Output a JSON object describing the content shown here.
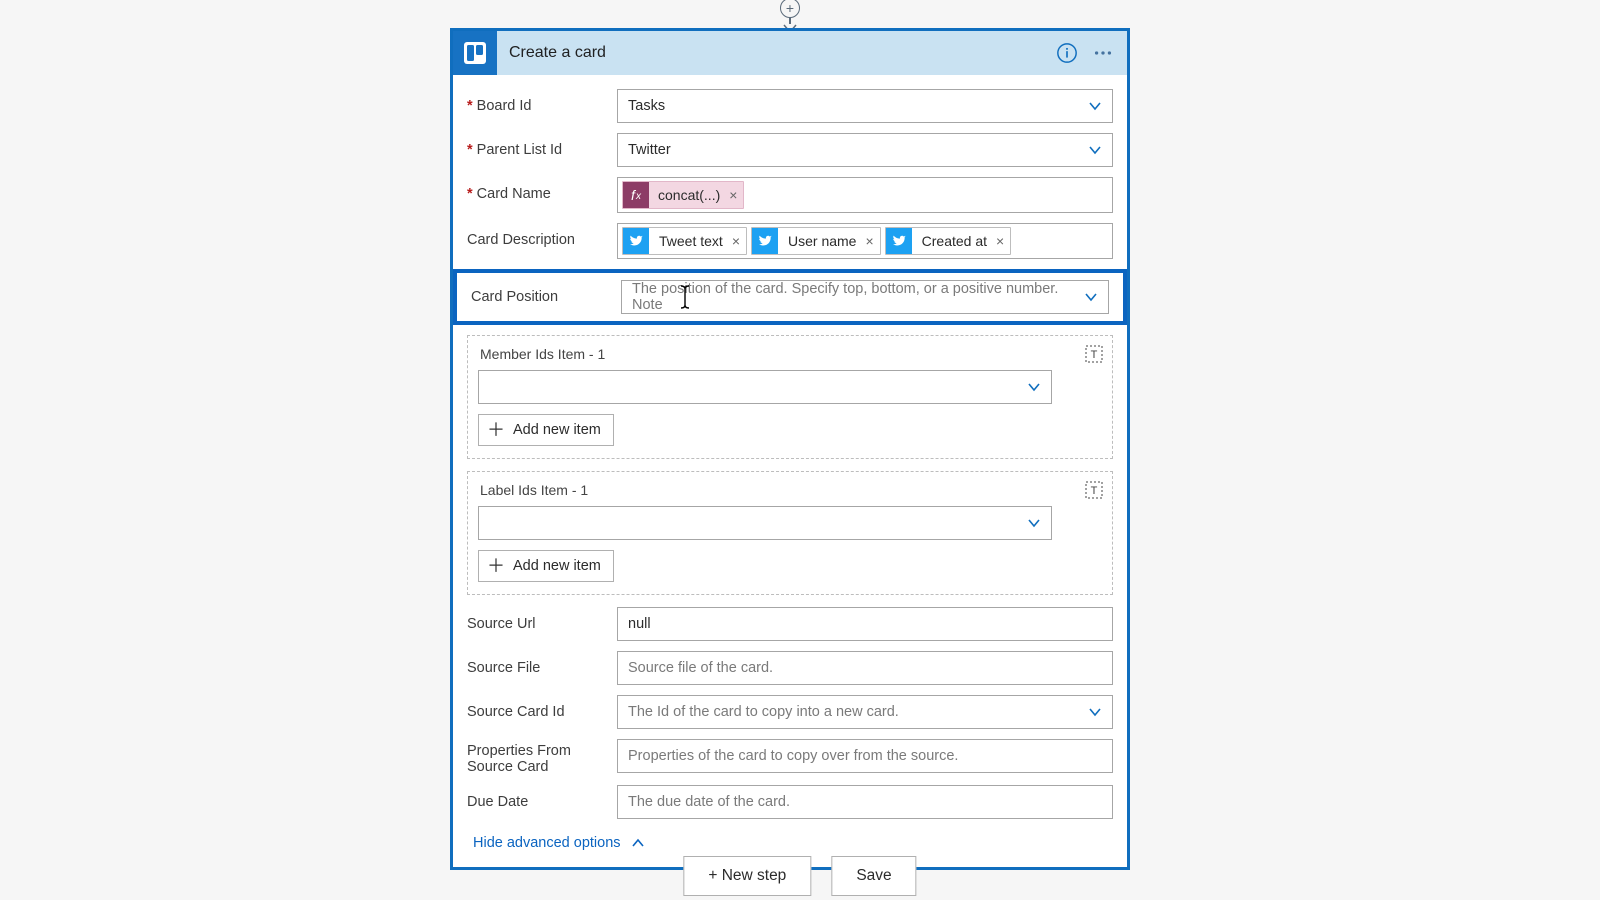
{
  "header": {
    "title": "Create a card"
  },
  "fields": {
    "board_id": {
      "label": "Board Id",
      "value": "Tasks"
    },
    "parent_list_id": {
      "label": "Parent List Id",
      "value": "Twitter"
    },
    "card_name": {
      "label": "Card Name",
      "tokens": [
        {
          "kind": "fx",
          "text": "concat(...)"
        }
      ]
    },
    "card_description": {
      "label": "Card Description",
      "tokens": [
        {
          "kind": "twitter",
          "text": "Tweet text"
        },
        {
          "kind": "twitter",
          "text": "User name"
        },
        {
          "kind": "twitter",
          "text": "Created at"
        }
      ]
    },
    "card_position": {
      "label": "Card Position",
      "placeholder": "The position of the card. Specify top, bottom, or a positive number. Note"
    },
    "member_ids": {
      "group_label": "Member Ids Item - 1",
      "add_label": "Add new item"
    },
    "label_ids": {
      "group_label": "Label Ids Item - 1",
      "add_label": "Add new item"
    },
    "source_url": {
      "label": "Source Url",
      "value": "null"
    },
    "source_file": {
      "label": "Source File",
      "placeholder": "Source file of the card."
    },
    "source_card_id": {
      "label": "Source Card Id",
      "placeholder": "The Id of the card to copy into a new card."
    },
    "properties_from_source": {
      "label": "Properties From Source Card",
      "placeholder": "Properties of the card to copy over from the source."
    },
    "due_date": {
      "label": "Due Date",
      "placeholder": "The due date of the card."
    }
  },
  "advanced_toggle": "Hide advanced options",
  "footer": {
    "new_step": "+ New step",
    "save": "Save"
  }
}
